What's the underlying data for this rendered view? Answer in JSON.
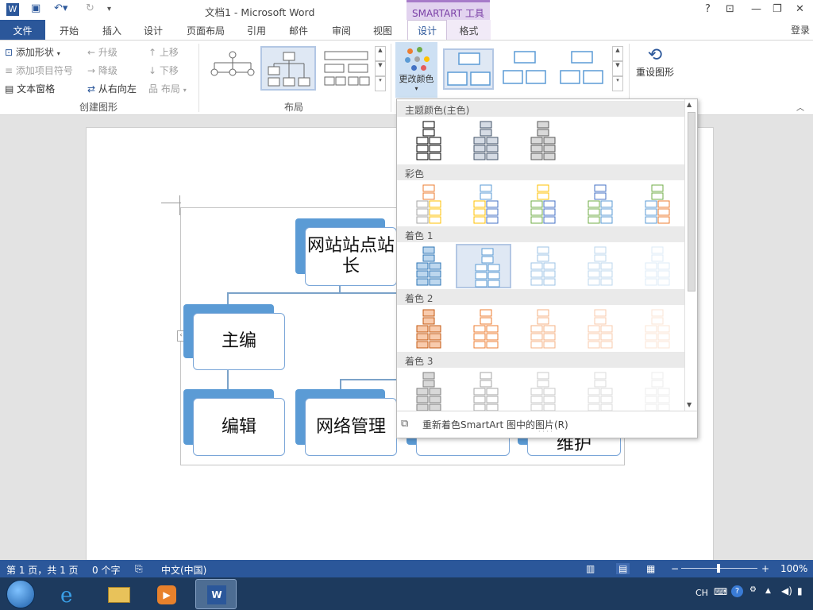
{
  "window": {
    "title": "文档1 - Microsoft Word",
    "context_tab_group": "SMARTART 工具",
    "login": "登录",
    "help": "?"
  },
  "tabs": [
    "文件",
    "开始",
    "插入",
    "设计",
    "页面布局",
    "引用",
    "邮件",
    "审阅",
    "视图"
  ],
  "context_tabs": {
    "design": "设计",
    "format": "格式"
  },
  "ribbon": {
    "create": {
      "add_shape": "添加形状",
      "add_bullet": "添加项目符号",
      "text_pane": "文本窗格",
      "promote": "升级",
      "demote": "降级",
      "rtl": "从右向左",
      "move_up": "上移",
      "move_down": "下移",
      "layout": "布局",
      "group_label": "创建图形"
    },
    "layouts_label": "布局",
    "change_colors": "更改颜色",
    "reset_graphic": "重设图形"
  },
  "color_panel": {
    "sections": [
      "主题颜色(主色)",
      "彩色",
      "着色 1",
      "着色 2",
      "着色 3"
    ],
    "footer": "重新着色SmartArt 图中的图片(R)",
    "palettes": {
      "primary": [
        [
          "#000000",
          "#ffffff"
        ],
        [
          "#44546a",
          "#d6dce5"
        ],
        [
          "#595959",
          "#d9d9d9"
        ]
      ],
      "colorful": [
        [
          "#ed7d31",
          "#a5a5a5",
          "#ffc000"
        ],
        [
          "#5b9bd5",
          "#ffc000",
          "#4472c4"
        ],
        [
          "#ffc000",
          "#70ad47",
          "#4472c4"
        ],
        [
          "#4472c4",
          "#70ad47",
          "#5b9bd5"
        ],
        [
          "#70ad47",
          "#5b9bd5",
          "#ed7d31"
        ]
      ],
      "accent1": [
        "#2e75b6",
        "#5b9bd5",
        "#9dc3e6",
        "#bdd7ee",
        "#deebf7"
      ],
      "accent2": [
        "#c55a11",
        "#ed7d31",
        "#f4b183",
        "#f8cbad",
        "#fbe5d6"
      ],
      "accent3": [
        "#7f7f7f",
        "#a5a5a5",
        "#c9c9c9",
        "#dbdbdb",
        "#ededed"
      ]
    }
  },
  "diagram": {
    "top": "网站站点站长",
    "left": "主编",
    "bottom_left": "编辑",
    "bottom_mid": "网络管理",
    "partial": "维护"
  },
  "status": {
    "page": "第 1 页，共 1 页",
    "words": "0 个字",
    "lang": "中文(中国)",
    "zoom": "100%"
  },
  "tray": {
    "lang": "CH"
  }
}
